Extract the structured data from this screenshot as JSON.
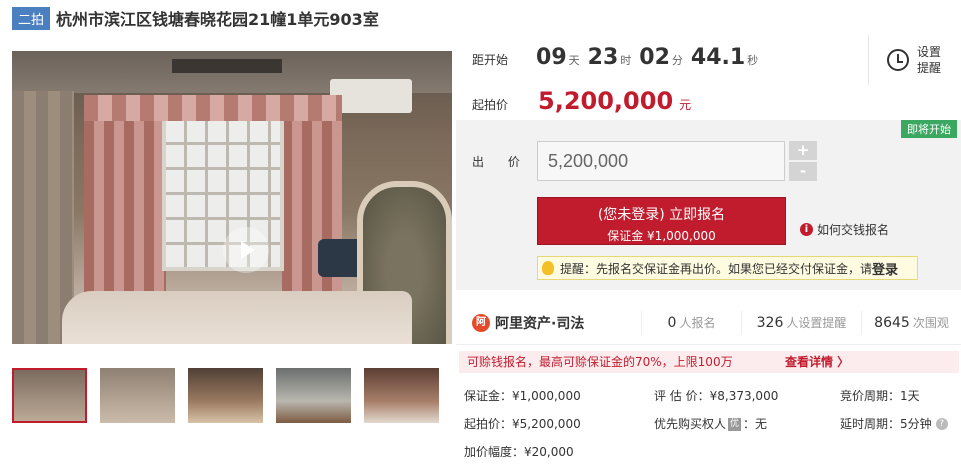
{
  "header": {
    "badge": "二拍",
    "title": "杭州市滨江区钱塘春晓花园21幢1单元903室"
  },
  "timer": {
    "label": "距开始",
    "days": "09",
    "days_unit": "天",
    "hours": "23",
    "hours_unit": "时",
    "minutes": "02",
    "minutes_unit": "分",
    "seconds": "44.1",
    "seconds_unit": "秒"
  },
  "remind": {
    "label": "设置提醒",
    "icon": "alarm-clock-icon"
  },
  "start_price": {
    "label": "起拍价",
    "value": "5,200,000",
    "unit": "元"
  },
  "bid": {
    "status_badge": "即将开始",
    "label": "出 价",
    "input_value": "5,200,000",
    "plus": "+",
    "minus": "-",
    "signup_line1": "(您未登录) 立即报名",
    "signup_line2": "保证金 ¥1,000,000",
    "how_to": "如何交钱报名",
    "tip_text": "提醒：先报名交保证金再出价。如果您已经交付保证金，请",
    "tip_login": "登录"
  },
  "brand": {
    "name": "阿里资产·司法",
    "stats": [
      {
        "value": "0",
        "suffix": "人报名"
      },
      {
        "value": "326",
        "suffix": "人设置提醒"
      },
      {
        "value": "8645",
        "suffix": "次围观"
      }
    ]
  },
  "promo": {
    "text": "可赊钱报名，最高可赊保证金的70%，上限100万",
    "link": "查看详情 〉"
  },
  "details": {
    "deposit": "保证金：¥1,000,000",
    "appraisal": "评 估 价：¥8,373,000",
    "period": "竞价周期：1天",
    "start": "起拍价：¥5,200,000",
    "priority_label": "优先购买权人",
    "priority_value": "：无",
    "extension": "延时周期：5分钟",
    "increment": "加价幅度：¥20,000"
  },
  "colors": {
    "accent": "#c11c2e",
    "badge_blue": "#4a7fc0",
    "soon_green": "#3aa861"
  }
}
